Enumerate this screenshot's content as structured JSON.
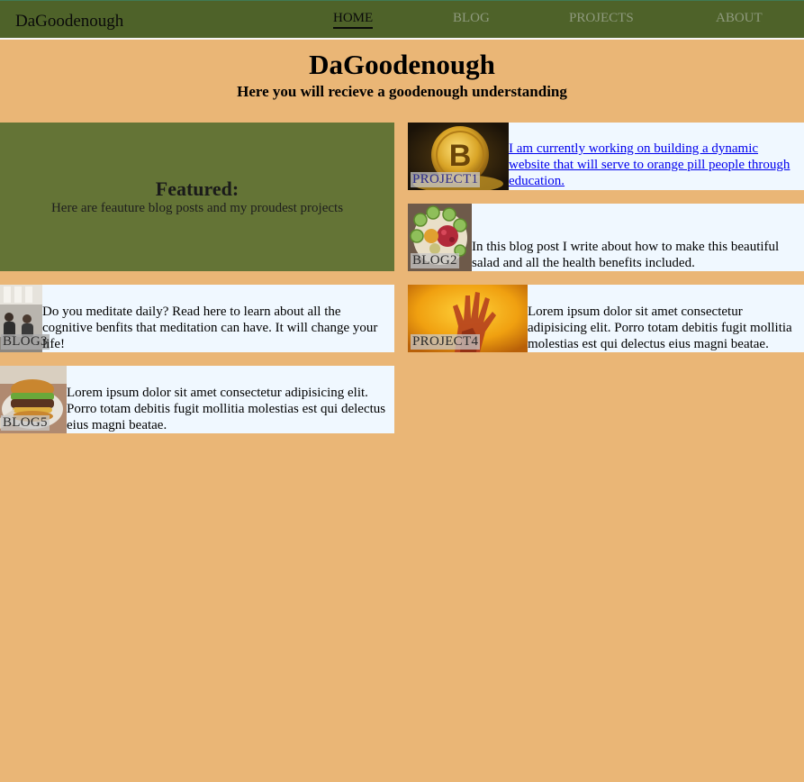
{
  "nav": {
    "brand": "DaGoodenough",
    "links": [
      {
        "label": "HOME",
        "active": true
      },
      {
        "label": "BLOG",
        "active": false
      },
      {
        "label": "PROJECTS",
        "active": false
      },
      {
        "label": "ABOUT",
        "active": false
      }
    ]
  },
  "hero": {
    "title": "DaGoodenough",
    "subtitle": "Here you will recieve a goodenough understanding"
  },
  "featured": {
    "title": "Featured:",
    "description": "Here are feauture blog posts and my proudest projects"
  },
  "cards": [
    {
      "label": "PROJECT1",
      "image": "bitcoin-image",
      "text": "I am currently working on building a dynamic website that will serve to orange pill people through education.",
      "is_link": true
    },
    {
      "label": "BLOG2",
      "image": "salad-image",
      "text": "In this blog post I write about how to make this beautiful salad and all the health benefits included.",
      "is_link": false
    },
    {
      "label": "BLOG3",
      "image": "meditation-image",
      "text": "Do you meditate daily? Read here to learn about all the cognitive benfits that meditation can have. It will change your life!",
      "is_link": false
    },
    {
      "label": "PROJECT4",
      "image": "hand-image",
      "text": "Lorem ipsum dolor sit amet consectetur adipisicing elit. Porro totam debitis fugit mollitia molestias est qui delectus eius magni beatae.",
      "is_link": false
    },
    {
      "label": "BLOG5",
      "image": "burger-image",
      "text": "Lorem ipsum dolor sit amet consectetur adipisicing elit. Porro totam debitis fugit mollitia molestias est qui delectus eius magni beatae.",
      "is_link": false
    }
  ],
  "colors": {
    "background": "#EAB676",
    "navbar": "#4E6229",
    "featured": "#647436",
    "card": "#F0F8FF",
    "link": "#0000EE"
  }
}
